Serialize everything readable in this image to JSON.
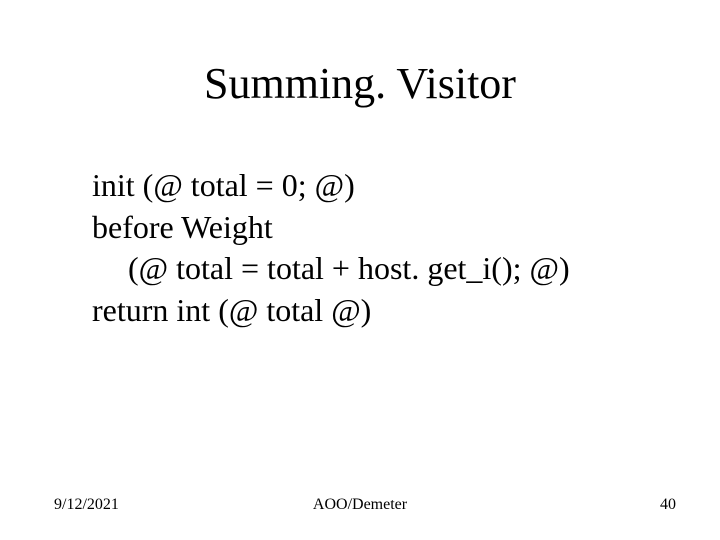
{
  "title": "Summing. Visitor",
  "code": {
    "line1": "init (@ total = 0; @)",
    "line2": "before Weight",
    "line3": "(@ total = total + host. get_i(); @)",
    "line4": "return int (@ total @)"
  },
  "footer": {
    "date": "9/12/2021",
    "center": "AOO/Demeter",
    "page": "40"
  }
}
